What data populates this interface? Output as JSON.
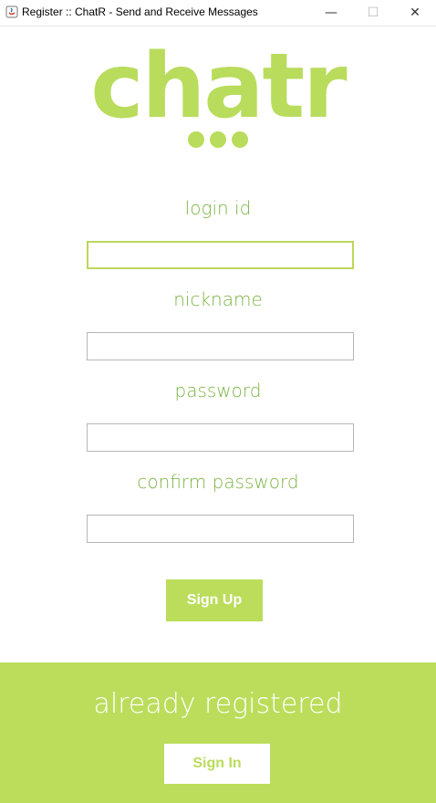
{
  "window": {
    "title": "Register :: ChatR - Send and Receive Messages",
    "icon": "java-icon",
    "minimize_glyph": "—",
    "maximize_glyph": "☐",
    "close_glyph": "✕"
  },
  "logo": {
    "wordmark": "chatr",
    "color": "#b9dc5c"
  },
  "form": {
    "login_label": "login id",
    "login_value": "",
    "nickname_label": "nickname",
    "nickname_value": "",
    "password_label": "password",
    "password_value": "",
    "confirm_label": "confirm password",
    "confirm_value": ""
  },
  "signup_button": "Sign Up",
  "footer": {
    "title": "already registered",
    "signin_button": "Sign In"
  },
  "colors": {
    "accent": "#bbdd5b",
    "label": "#7cb443"
  }
}
